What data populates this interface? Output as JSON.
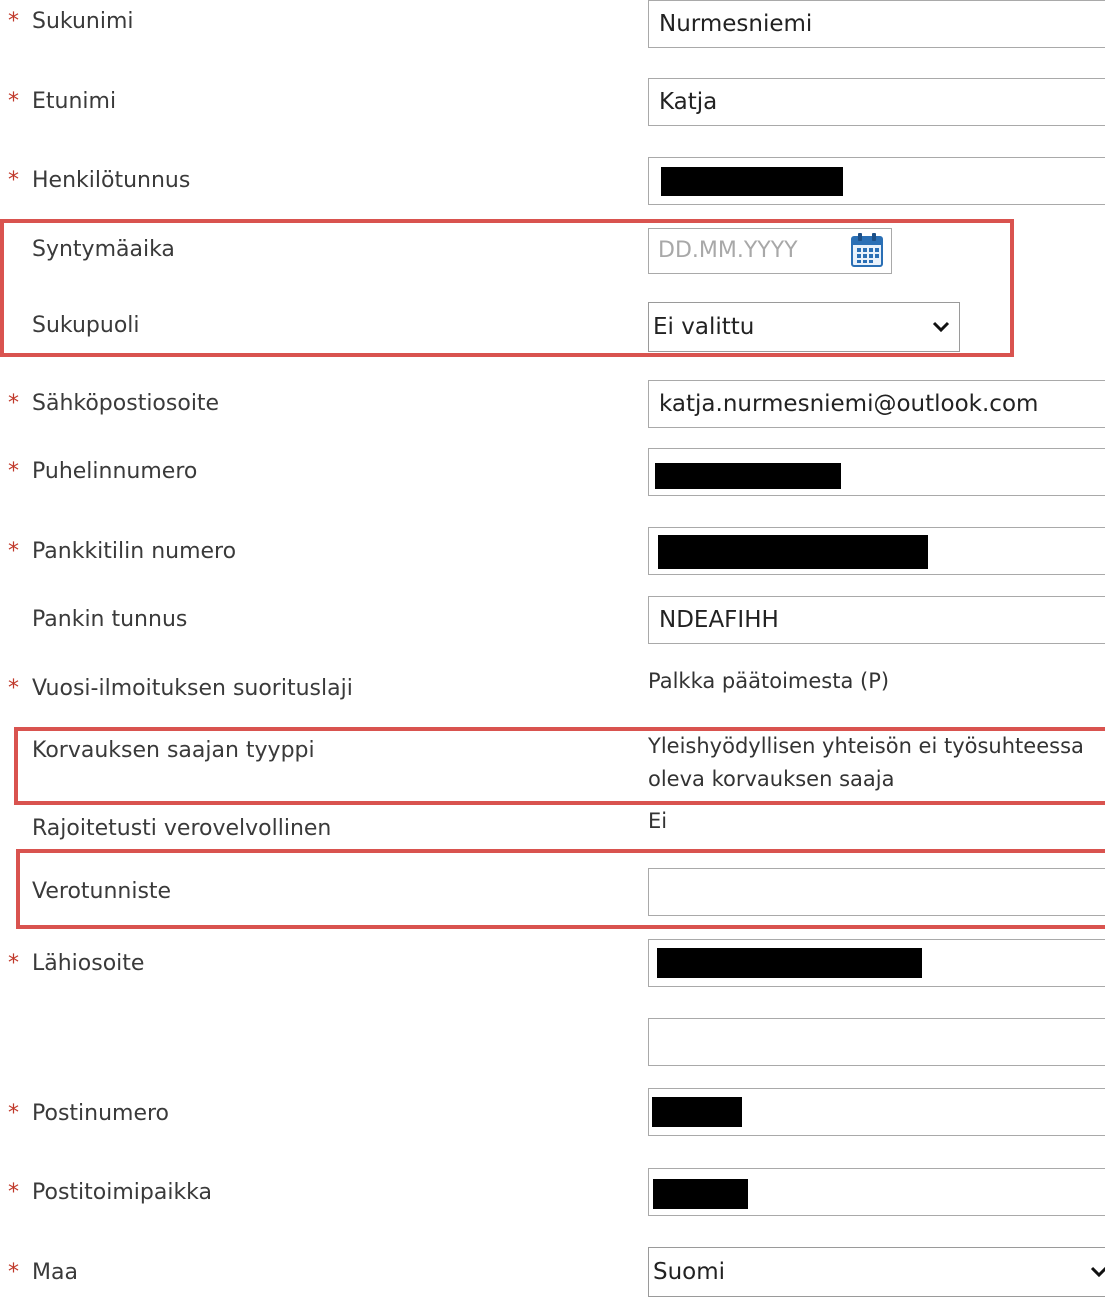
{
  "fields": {
    "sukunimi": {
      "label": "Sukunimi",
      "value": "Nurmesniemi"
    },
    "etunimi": {
      "label": "Etunimi",
      "value": "Katja"
    },
    "henkilotunnus": {
      "label": "Henkilötunnus"
    },
    "syntymaaika": {
      "label": "Syntymäaika",
      "placeholder": "DD.MM.YYYY"
    },
    "sukupuoli": {
      "label": "Sukupuoli",
      "value": "Ei valittu"
    },
    "sahkoposti": {
      "label": "Sähköpostiosoite",
      "value": "katja.nurmesniemi@outlook.com"
    },
    "puhelin": {
      "label": "Puhelinnumero"
    },
    "pankkitili": {
      "label": "Pankkitilin numero"
    },
    "pankin_tunnus": {
      "label": "Pankin tunnus",
      "value": "NDEAFIHH"
    },
    "suorituslaji": {
      "label": "Vuosi-ilmoituksen suorituslaji",
      "value": "Palkka päätoimesta (P)"
    },
    "saajan_tyyppi": {
      "label": "Korvauksen saajan tyyppi",
      "value_line1": "Yleishyödyllisen yhteisön ei työsuhteessa",
      "value_line2": "oleva korvauksen saaja"
    },
    "rajoitetusti": {
      "label": "Rajoitetusti verovelvollinen",
      "value": "Ei"
    },
    "verotunniste": {
      "label": "Verotunniste",
      "value": ""
    },
    "lahiosoite": {
      "label": "Lähiosoite"
    },
    "postinumero": {
      "label": "Postinumero"
    },
    "postitoimipaikka": {
      "label": "Postitoimipaikka"
    },
    "maa": {
      "label": "Maa",
      "value": "Suomi"
    }
  },
  "required_marker": "*",
  "colors": {
    "required": "#c0392b",
    "highlight": "#d9534f",
    "redaction": "#000000"
  },
  "icons": {
    "calendar": "calendar-icon",
    "dropdown": "chevron-down-icon"
  }
}
